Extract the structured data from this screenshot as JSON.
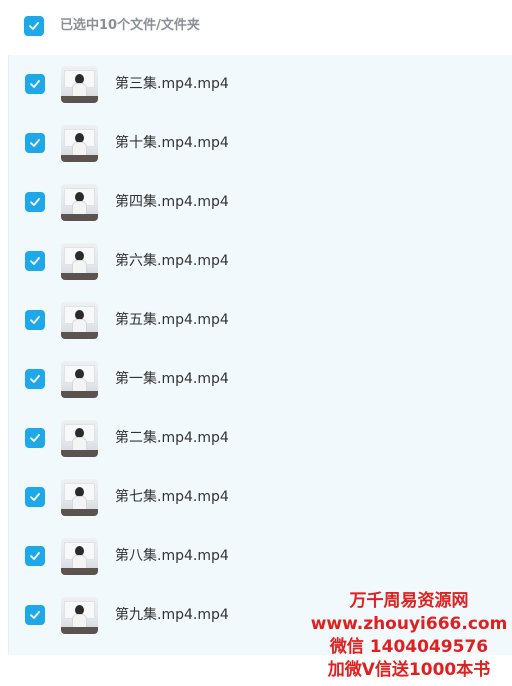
{
  "header": {
    "selection_label": "已选中10个文件/文件夹",
    "checked": true
  },
  "files": [
    {
      "name": "第三集.mp4.mp4",
      "checked": true
    },
    {
      "name": "第十集.mp4.mp4",
      "checked": true
    },
    {
      "name": "第四集.mp4.mp4",
      "checked": true
    },
    {
      "name": "第六集.mp4.mp4",
      "checked": true
    },
    {
      "name": "第五集.mp4.mp4",
      "checked": true
    },
    {
      "name": "第一集.mp4.mp4",
      "checked": true
    },
    {
      "name": "第二集.mp4.mp4",
      "checked": true
    },
    {
      "name": "第七集.mp4.mp4",
      "checked": true
    },
    {
      "name": "第八集.mp4.mp4",
      "checked": true
    },
    {
      "name": "第九集.mp4.mp4",
      "checked": true
    }
  ],
  "watermark": {
    "line1": "万千周易资源网",
    "line2": "www.zhouyi666.com",
    "line3": "微信 1404049576",
    "line4": "加微V信送1000本书"
  },
  "colors": {
    "accent": "#1ea8e7",
    "list_background": "#f2f9fd",
    "watermark": "#e02020"
  }
}
